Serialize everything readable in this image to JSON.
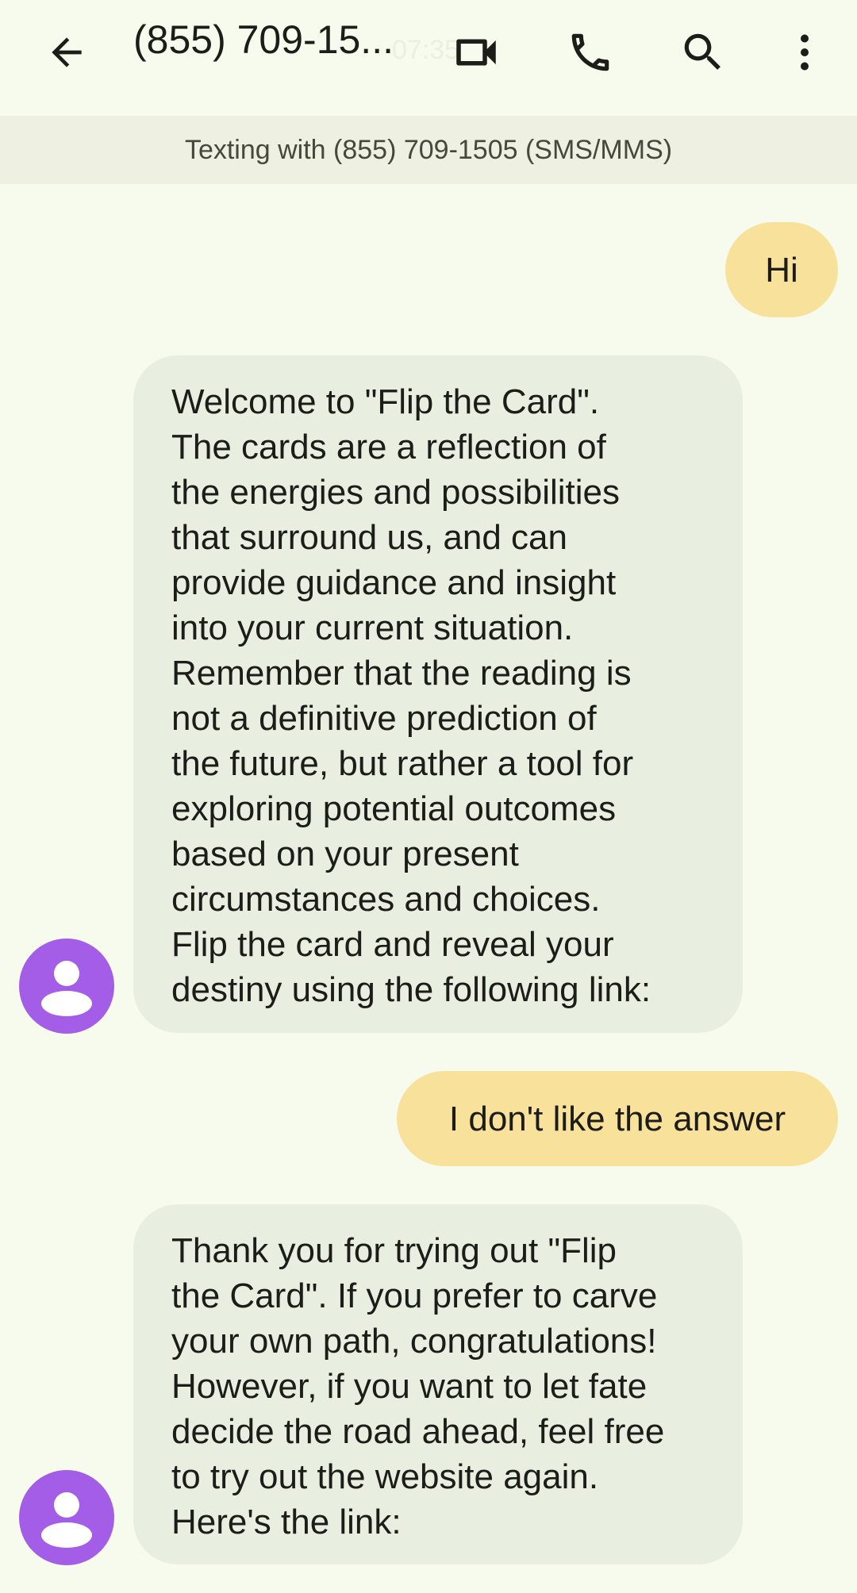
{
  "app_bar": {
    "back_icon": "arrow-back-icon",
    "title": "(855) 709-15...",
    "clock_ghost": "07:35",
    "video_icon": "videocam-icon",
    "call_icon": "phone-icon",
    "search_icon": "search-icon",
    "more_icon": "more-vert-icon"
  },
  "banner": {
    "text": "Texting with (855) 709-1505 (SMS/MMS)"
  },
  "colors": {
    "background": "#f7fbed",
    "banner": "#eef0e2",
    "outgoing_bubble": "#f8e19a",
    "incoming_bubble": "#e9efe0",
    "avatar": "#a35de6"
  },
  "messages": [
    {
      "direction": "outgoing",
      "lines": [
        "Hi"
      ]
    },
    {
      "direction": "incoming",
      "avatar_icon": "person-icon",
      "lines": [
        "Welcome to \"Flip the Card\".",
        "The cards are a reflection of",
        "the energies and possibilities",
        "that surround us, and can",
        "provide guidance and insight",
        "into your current situation.",
        "Remember that the reading is",
        "not a definitive prediction of",
        "the future, but rather a tool for",
        "exploring potential outcomes",
        "based on your present",
        "circumstances and choices.",
        "Flip the card and reveal your",
        "destiny using the following link:"
      ]
    },
    {
      "direction": "outgoing",
      "lines": [
        "I don't like the answer"
      ]
    },
    {
      "direction": "incoming",
      "avatar_icon": "person-icon",
      "lines": [
        "Thank you for trying out \"Flip",
        "the Card\". If you prefer to carve",
        "your own path, congratulations!",
        "However, if you want to let fate",
        "decide the road ahead, feel free",
        "to try out the website again.",
        "Here's the link:"
      ]
    }
  ]
}
